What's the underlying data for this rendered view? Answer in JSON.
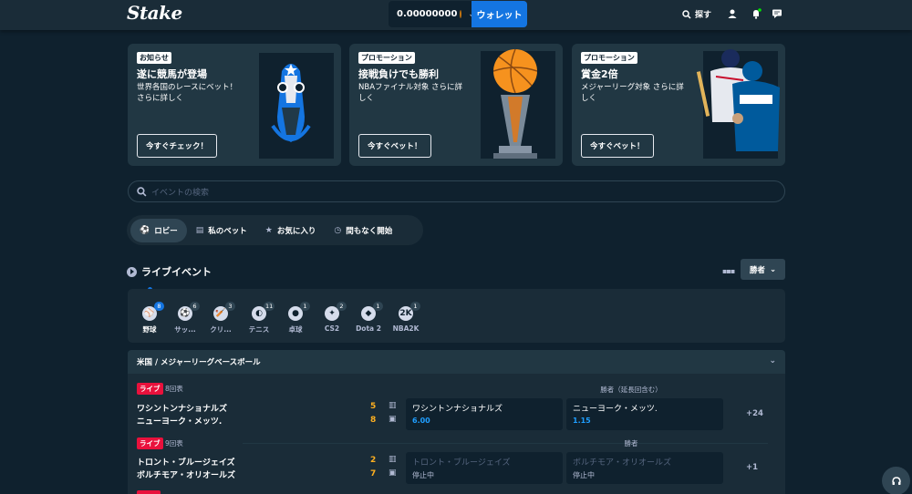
{
  "header": {
    "logo": "Stake",
    "balance": "0.00000000",
    "wallet": "ウォレット",
    "search": "探す",
    "icons": [
      "user-icon",
      "bell-icon",
      "chat-icon"
    ]
  },
  "banners": [
    {
      "tag": "お知らせ",
      "title": "遂に競馬が登場",
      "desc": "世界各国のレースにベット！さらに詳しく",
      "button": "今すぐチェック！",
      "art": "horse-art"
    },
    {
      "tag": "プロモーション",
      "title": "接戦負けでも勝利",
      "desc": "NBAファイナル対象 さらに詳しく",
      "button": "今すぐベット！",
      "art": "basketball-trophy-art"
    },
    {
      "tag": "プロモーション",
      "title": "賞金2倍",
      "desc": "メジャーリーグ対象 さらに詳しく",
      "button": "今すぐベット！",
      "art": "baseball-players-art"
    }
  ],
  "search": {
    "placeholder": "イベントの検索"
  },
  "tabs": [
    {
      "label": "ロビー",
      "icon": "lobby-icon",
      "active": true
    },
    {
      "label": "私のベット",
      "icon": "bets-icon",
      "active": false
    },
    {
      "label": "お気に入り",
      "icon": "star-icon",
      "active": false
    },
    {
      "label": "間もなく開始",
      "icon": "clock-icon",
      "active": false
    }
  ],
  "live": {
    "title": "ライブイベント",
    "filter": "勝者"
  },
  "sports": [
    {
      "label": "野球",
      "count": "8",
      "icon": "baseball-icon",
      "active": true
    },
    {
      "label": "サッ...",
      "count": "6",
      "icon": "soccer-icon",
      "active": false
    },
    {
      "label": "クリ...",
      "count": "3",
      "icon": "cricket-icon",
      "active": false
    },
    {
      "label": "テニス",
      "count": "11",
      "icon": "tennis-icon",
      "active": false
    },
    {
      "label": "卓球",
      "count": "1",
      "icon": "table-tennis-icon",
      "active": false
    },
    {
      "label": "CS2",
      "count": "2",
      "icon": "cs2-icon",
      "active": false
    },
    {
      "label": "Dota 2",
      "count": "1",
      "icon": "dota2-icon",
      "active": false
    },
    {
      "label": "NBA2K",
      "count": "1",
      "icon": "nba2k-icon",
      "active": false
    }
  ],
  "league": "米国 / メジャーリーグベースボール",
  "matches": [
    {
      "status": "ライブ",
      "period": "8回表",
      "market": "勝者（延長回含む）",
      "team1": "ワシントンナショナルズ",
      "team2": "ニューヨーク・メッツ.",
      "score1": "5",
      "score2": "8",
      "odds": [
        {
          "name": "ワシントンナショナルズ",
          "value": "6.00",
          "suspended": false
        },
        {
          "name": "ニューヨーク・メッツ.",
          "value": "1.15",
          "suspended": false
        }
      ],
      "more": "+24"
    },
    {
      "status": "ライブ",
      "period": "9回表",
      "market": "勝者",
      "team1": "トロント・ブルージェイズ",
      "team2": "ボルチモア・オリオールズ",
      "score1": "2",
      "score2": "7",
      "odds": [
        {
          "name": "トロント・ブルージェイズ",
          "value": "停止中",
          "suspended": true
        },
        {
          "name": "ボルチモア・オリオールズ",
          "value": "停止中",
          "suspended": true
        }
      ],
      "more": "+1"
    }
  ]
}
